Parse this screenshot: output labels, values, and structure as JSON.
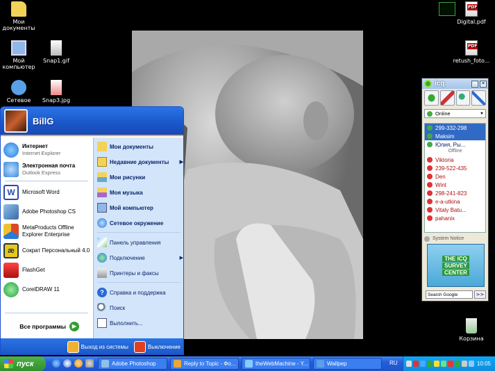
{
  "desktop_icons": [
    {
      "label": "Мои документы",
      "icon": "folder-icon",
      "color": "#f4d25a"
    },
    {
      "label": "Мой компьютер",
      "icon": "computer-icon",
      "color": "#8fb8e8"
    },
    {
      "label": "Snap1.gif",
      "icon": "image-file-icon",
      "color": "#e8e8e8"
    },
    {
      "label": "Сетевое",
      "icon": "network-icon",
      "color": "#5aa0e8"
    },
    {
      "label": "Snap3.jpg",
      "icon": "image-file-icon",
      "color": "#e8e8e8"
    },
    {
      "label": "Digital.pdf",
      "icon": "pdf-icon",
      "color": "#cc0000"
    },
    {
      "label": "retush_foto...",
      "icon": "pdf-icon",
      "color": "#cc0000"
    },
    {
      "label": "Корзина",
      "icon": "recycle-bin-icon",
      "color": "#5ac85a"
    }
  ],
  "start_menu": {
    "user": "BillG",
    "pinned": [
      {
        "title": "Интернет",
        "subtitle": "Internet Explorer",
        "icon": "internet-explorer-icon",
        "color": "#2a7ad8"
      },
      {
        "title": "Электронная почта",
        "subtitle": "Outlook Express",
        "icon": "outlook-express-icon",
        "color": "#3a8ad8"
      }
    ],
    "recent": [
      {
        "label": "Microsoft Word",
        "icon": "word-icon",
        "color": "#2a4aa8"
      },
      {
        "label": "Adobe Photoshop CS",
        "icon": "photoshop-icon",
        "color": "#3a6aa8"
      },
      {
        "label": "MetaProducts Offline Explorer Enterprise",
        "icon": "offline-explorer-icon",
        "color": "#d84a2a"
      },
      {
        "label": "Сократ Персональный 4.0",
        "icon": "socrat-icon",
        "color": "#e8c818"
      },
      {
        "label": "FlashGet",
        "icon": "flashget-icon",
        "color": "#d82a2a"
      },
      {
        "label": "CorelDRAW 11",
        "icon": "coreldraw-icon",
        "color": "#2a9a4a"
      }
    ],
    "all_programs": "Все программы",
    "right": [
      {
        "label": "Мои документы",
        "icon": "folder-icon",
        "bold": true,
        "arrow": false
      },
      {
        "label": "Недавние документы",
        "icon": "recent-docs-icon",
        "bold": true,
        "arrow": true
      },
      {
        "label": "Мои рисунки",
        "icon": "pictures-folder-icon",
        "bold": true,
        "arrow": false
      },
      {
        "label": "Моя музыка",
        "icon": "music-folder-icon",
        "bold": true,
        "arrow": false
      },
      {
        "label": "Мой компьютер",
        "icon": "computer-icon",
        "bold": true,
        "arrow": false
      },
      {
        "label": "Сетевое окружение",
        "icon": "network-icon",
        "bold": true,
        "arrow": false
      },
      {
        "label": "Панель управления",
        "icon": "control-panel-icon",
        "bold": false,
        "arrow": false
      },
      {
        "label": "Подключение",
        "icon": "connect-icon",
        "bold": false,
        "arrow": true
      },
      {
        "label": "Принтеры и факсы",
        "icon": "printer-icon",
        "bold": false,
        "arrow": false
      },
      {
        "label": "Справка и поддержка",
        "icon": "help-icon",
        "bold": false,
        "arrow": false
      },
      {
        "label": "Поиск",
        "icon": "search-icon",
        "bold": false,
        "arrow": false
      },
      {
        "label": "Выполнить...",
        "icon": "run-icon",
        "bold": false,
        "arrow": false
      }
    ],
    "logoff": "Выход из системы",
    "shutdown": "Выключение"
  },
  "taskbar": {
    "start_label": "пуск",
    "buttons": [
      {
        "label": "Adobe Photoshop",
        "icon": "photoshop-icon",
        "color": "#3a6aa8"
      },
      {
        "label": "Reply to Topic - Фо...",
        "icon": "browser-icon",
        "color": "#e8a838"
      },
      {
        "label": "theWebMachine - Y...",
        "icon": "browser-icon",
        "color": "#2a7ad8"
      },
      {
        "label": "Wallpep",
        "icon": "wallpep-icon",
        "color": "#5aa0e8"
      }
    ],
    "language": "RU",
    "clock": "10:05"
  },
  "icq": {
    "title": "icq",
    "status": "Online",
    "contacts_online": [
      {
        "name": "299-332-298",
        "selected": true
      },
      {
        "name": "Maksim",
        "selected": true
      },
      {
        "name": "Юлия, Ры...",
        "selected": false
      }
    ],
    "offline_label": "Offline",
    "contacts_offline": [
      "Viktoria",
      "239-522-435",
      "Den",
      "Wint",
      "298-241-823",
      "e-a-utkina",
      "Vitaly Batu...",
      "pahanix"
    ],
    "system_notice": "System Notice",
    "ad_lines": [
      "THE ICQ",
      "SURVEY",
      "CENTER"
    ],
    "search_label": "Search Google",
    "go_label": ">>"
  }
}
